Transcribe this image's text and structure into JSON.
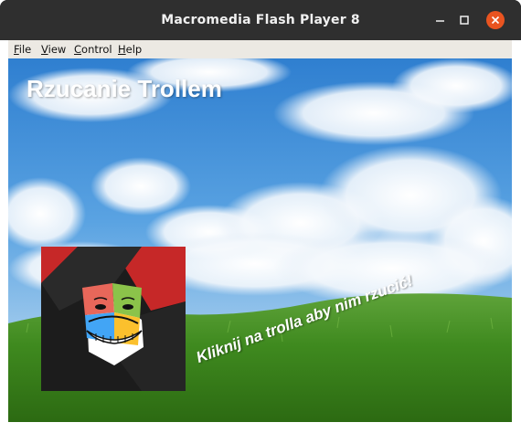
{
  "window": {
    "title": "Macromedia Flash Player 8"
  },
  "menubar": {
    "items": [
      {
        "label": "File",
        "mnemonic": "F",
        "rest": "ile"
      },
      {
        "label": "View",
        "mnemonic": "V",
        "rest": "iew"
      },
      {
        "label": "Control",
        "mnemonic": "C",
        "rest": "ontrol"
      },
      {
        "label": "Help",
        "mnemonic": "H",
        "rest": "elp"
      }
    ]
  },
  "game": {
    "title": "Rzucanie Trollem",
    "hint": "Kliknij na trolla aby nim rzucić!"
  },
  "colors": {
    "titlebar": "#2f2f2f",
    "close_button": "#e95420",
    "menubar": "#ece9e3",
    "sky": "#3f8fd8",
    "grass": "#3f8a1f",
    "troll_tile_bg": "#1c1c1c",
    "troll_tile_accent": "#c62828"
  },
  "icons": {
    "minimize": "minimize-icon",
    "maximize": "maximize-icon",
    "close": "close-icon",
    "troll": "trollface-icon"
  }
}
